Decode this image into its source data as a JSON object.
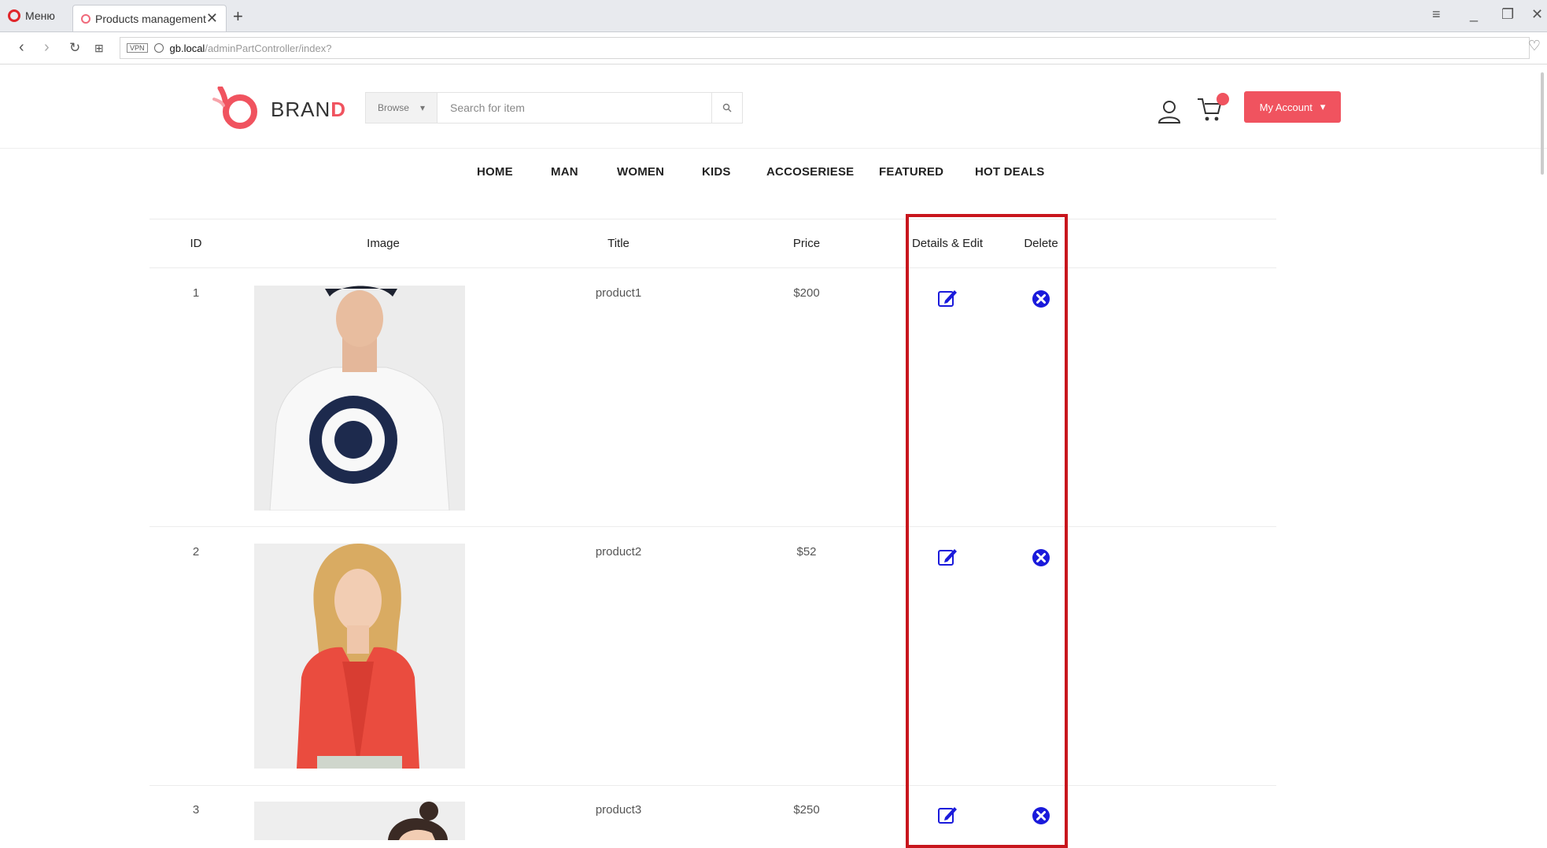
{
  "browser": {
    "menu_label": "Меню",
    "tab_title": "Products management",
    "url_host": "gb.local",
    "url_path": "/adminPartController/index?",
    "vpn_label": "VPN"
  },
  "header": {
    "brand_text": "BRAN",
    "brand_accent": "D",
    "browse_label": "Browse",
    "search_placeholder": "Search for item",
    "account_label": "My Account"
  },
  "nav": {
    "items": [
      "HOME",
      "MAN",
      "WOMEN",
      "KIDS",
      "ACCOSERIESE",
      "FEATURED",
      "HOT DEALS"
    ]
  },
  "table": {
    "headers": {
      "id": "ID",
      "image": "Image",
      "title": "Title",
      "price": "Price",
      "details": "Details & Edit",
      "delete": "Delete"
    },
    "rows": [
      {
        "id": "1",
        "title": "product1",
        "price": "$200",
        "image": "man in white printed t-shirt and cap"
      },
      {
        "id": "2",
        "title": "product2",
        "price": "$52",
        "image": "woman in red ruffled sleeveless blouse"
      },
      {
        "id": "3",
        "title": "product3",
        "price": "$250",
        "image": "woman with hair bun"
      }
    ]
  },
  "colors": {
    "accent": "#f0535f",
    "highlight": "#c8161d",
    "action_icon": "#1a1adb"
  },
  "icons": [
    "opera-icon",
    "close-icon",
    "plus-icon",
    "back-icon",
    "forward-icon",
    "reload-icon",
    "tiles-icon",
    "globe-icon",
    "heart-icon",
    "user-icon",
    "cart-icon",
    "search-icon",
    "caret-down-icon",
    "edit-icon",
    "delete-icon"
  ]
}
